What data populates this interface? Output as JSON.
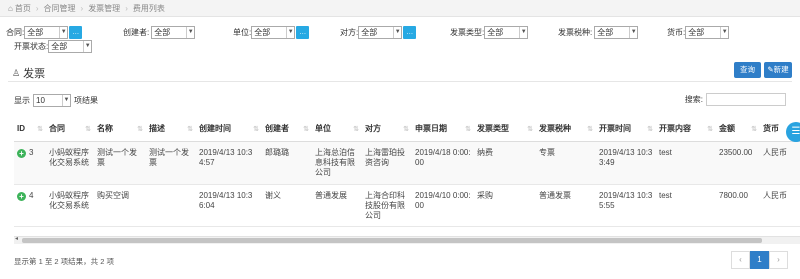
{
  "breadcrumb": {
    "home": "首页",
    "items": [
      "合同管理",
      "发票管理",
      "费用列表"
    ]
  },
  "filters": {
    "row1": [
      {
        "label": "合同:",
        "value": "全部",
        "has_button": true
      },
      {
        "label": "创建者:",
        "value": "全部",
        "has_button": false
      },
      {
        "label": "单位:",
        "value": "全部",
        "has_button": true
      },
      {
        "label": "对方:",
        "value": "全部",
        "has_button": true
      },
      {
        "label": "发票类型:",
        "value": "全部",
        "has_button": false
      },
      {
        "label": "发票税种:",
        "value": "全部",
        "has_button": false
      },
      {
        "label": "货币:",
        "value": "全部",
        "has_button": false
      }
    ],
    "row2": [
      {
        "label": "开票状态:",
        "value": "全部",
        "has_button": false
      }
    ]
  },
  "panel": {
    "title": "发票",
    "query_label": "查询",
    "new_label": "新建"
  },
  "length": {
    "prefix": "显示",
    "value": "10",
    "suffix": "项结果"
  },
  "search": {
    "label": "搜索:"
  },
  "table": {
    "headers": [
      "ID",
      "合同",
      "名称",
      "描述",
      "创建时间",
      "创建者",
      "单位",
      "对方",
      "申票日期",
      "发票类型",
      "发票税种",
      "开票时间",
      "开票内容",
      "金额",
      "货币"
    ],
    "rows": [
      [
        "3",
        "小蚂蚁程序化交易系统",
        "测试一个发票",
        "测试一个发票",
        "2019/4/13 10:34:57",
        "郎璐璐",
        "上海总泊信息科技有限公司",
        "上海雷珀投资咨询",
        "2019/4/18 0:00:00",
        "纳费",
        "专票",
        "2019/4/13 10:33:49",
        "test",
        "23500.00",
        "人民币"
      ],
      [
        "4",
        "小蚂蚁程序化交易系统",
        "购买空调",
        "",
        "2019/4/13 10:36:04",
        "谢义",
        "普通发展",
        "上海合印科技股份有限公司",
        "2019/4/10 0:00:00",
        "采购",
        "普通发票",
        "2019/4/13 10:35:55",
        "test",
        "7800.00",
        "人民币"
      ]
    ]
  },
  "footer": {
    "info": "显示第 1 至 2 项结果，共 2 项",
    "prev": "‹",
    "page": "1",
    "next": "›"
  },
  "icons": {
    "home": "home-icon",
    "panel": "user-icon",
    "new": "pencil-icon",
    "expand": "plus-circle-icon",
    "float": "menu-icon"
  },
  "colors": {
    "primary": "#2f7ec8",
    "filter_button": "#27a9e3",
    "expand": "#3db35a",
    "float": "#29a3e0"
  }
}
